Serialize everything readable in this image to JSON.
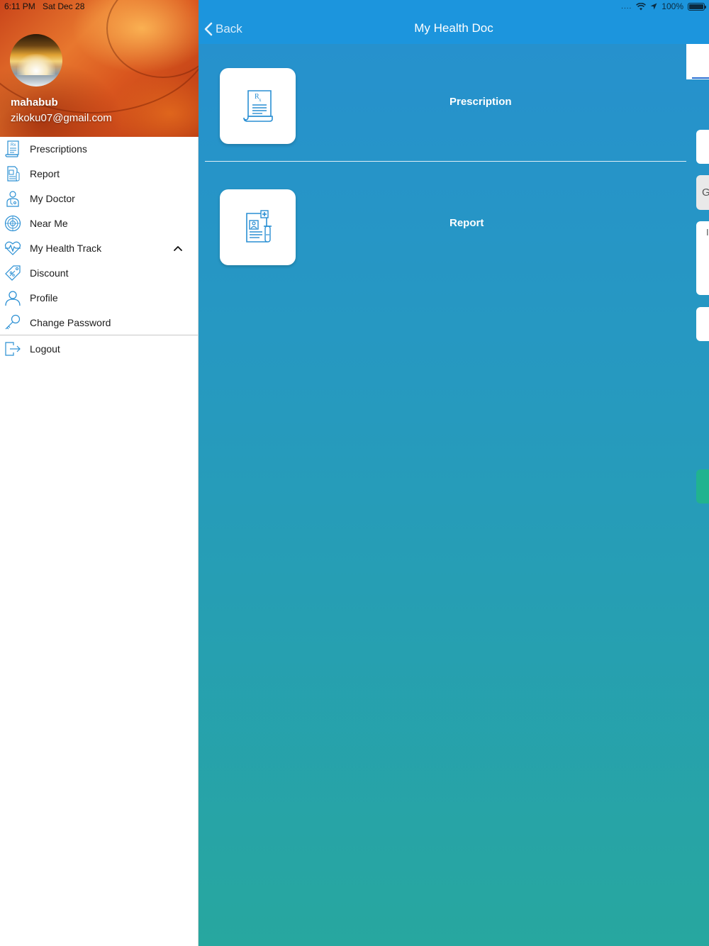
{
  "status_bar": {
    "time": "6:11 PM",
    "date": "Sat Dec 28",
    "signal_dots": "....",
    "battery": "100%"
  },
  "drawer": {
    "user": {
      "name": "mahabub",
      "email": "zikoku07@gmail.com"
    },
    "menu": [
      {
        "label": "Prescriptions",
        "icon": "prescription-icon"
      },
      {
        "label": "Report",
        "icon": "report-icon"
      },
      {
        "label": "My Doctor",
        "icon": "doctor-icon"
      },
      {
        "label": "Near Me",
        "icon": "radar-icon"
      },
      {
        "label": "My Health Track",
        "icon": "heartbeat-icon",
        "expanded": true
      },
      {
        "label": "Discount",
        "icon": "discount-tag-icon"
      },
      {
        "label": "Profile",
        "icon": "profile-icon"
      },
      {
        "label": "Change Password",
        "icon": "key-icon"
      }
    ],
    "logout": {
      "label": "Logout",
      "icon": "logout-icon"
    }
  },
  "main": {
    "back_label": "Back",
    "title": "My Health Doc",
    "cards": [
      {
        "label": "Prescription",
        "icon": "prescription-doc-icon"
      },
      {
        "label": "Report",
        "icon": "medical-report-icon"
      }
    ],
    "peek_letters": [
      "G",
      "I"
    ]
  },
  "colors": {
    "navbar": "#1c95dd",
    "gradient_top": "#2690cf",
    "gradient_bottom": "#27a79f",
    "icon_blue": "#2a8fd3",
    "accent_teal": "#21b38f"
  }
}
